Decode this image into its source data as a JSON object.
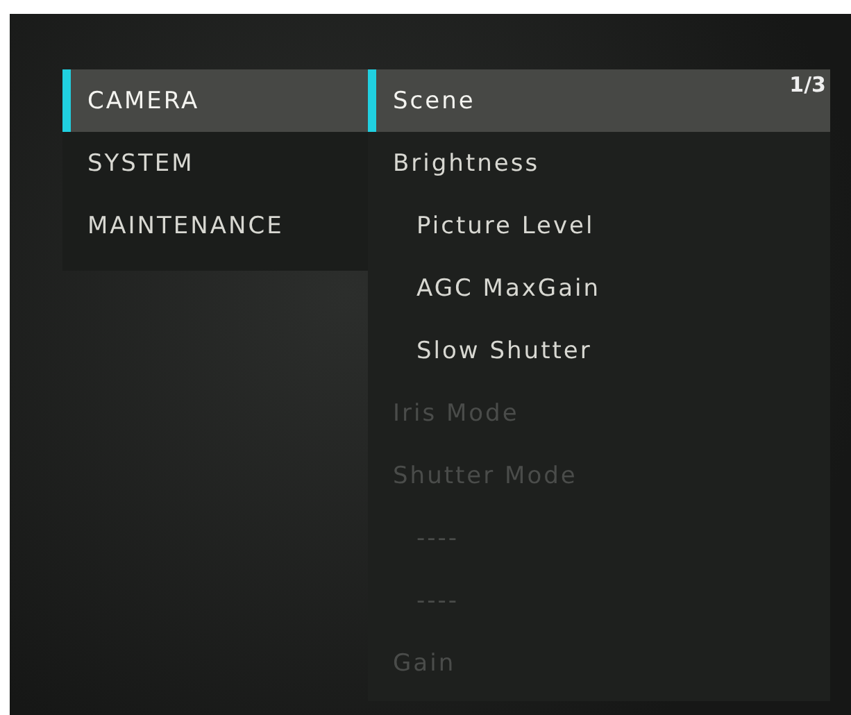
{
  "categories": [
    {
      "label": "CAMERA",
      "selected": true
    },
    {
      "label": "SYSTEM",
      "selected": false
    },
    {
      "label": "MAINTENANCE",
      "selected": false
    }
  ],
  "page_indicator": "1/3",
  "items": [
    {
      "label": "Scene",
      "selected": true,
      "disabled": false
    },
    {
      "label": "Brightness",
      "selected": false,
      "disabled": false,
      "children": [
        {
          "label": "Picture Level",
          "selected": false,
          "disabled": false
        },
        {
          "label": "AGC MaxGain",
          "selected": false,
          "disabled": false
        },
        {
          "label": "Slow Shutter",
          "selected": false,
          "disabled": false
        }
      ]
    },
    {
      "label": "Iris Mode",
      "selected": false,
      "disabled": true
    },
    {
      "label": "Shutter Mode",
      "selected": false,
      "disabled": true,
      "children": [
        {
          "label": "----",
          "selected": false,
          "disabled": true
        },
        {
          "label": "----",
          "selected": false,
          "disabled": true
        }
      ]
    },
    {
      "label": "Gain",
      "selected": false,
      "disabled": true
    }
  ]
}
